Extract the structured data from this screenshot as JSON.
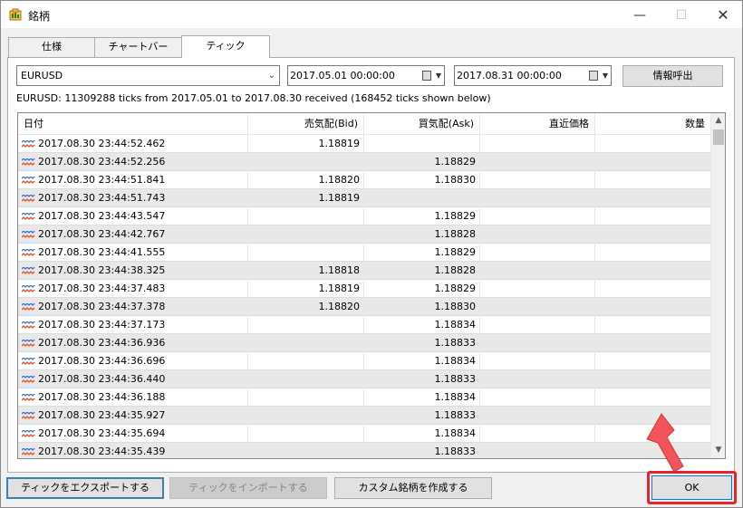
{
  "window": {
    "title": "銘柄",
    "minimize": "—",
    "maximize": "☐",
    "close": "✕"
  },
  "tabs": [
    {
      "label": "仕様"
    },
    {
      "label": "チャートバー"
    },
    {
      "label": "ティック"
    }
  ],
  "toolbar": {
    "symbol": "EURUSD",
    "date_from": "2017.05.01 00:00:00",
    "date_to": "2017.08.31 00:00:00",
    "fetch_label": "情報呼出"
  },
  "summary": "EURUSD: 11309288 ticks from 2017.05.01 to 2017.08.30 received (168452 ticks shown below)",
  "grid": {
    "columns": [
      "日付",
      "売気配(Bid)",
      "買気配(Ask)",
      "直近価格",
      "数量"
    ],
    "rows": [
      {
        "date": "2017.08.30 23:44:52.462",
        "bid": "1.18819",
        "ask": "",
        "last": "",
        "volume": ""
      },
      {
        "date": "2017.08.30 23:44:52.256",
        "bid": "",
        "ask": "1.18829",
        "last": "",
        "volume": ""
      },
      {
        "date": "2017.08.30 23:44:51.841",
        "bid": "1.18820",
        "ask": "1.18830",
        "last": "",
        "volume": ""
      },
      {
        "date": "2017.08.30 23:44:51.743",
        "bid": "1.18819",
        "ask": "",
        "last": "",
        "volume": ""
      },
      {
        "date": "2017.08.30 23:44:43.547",
        "bid": "",
        "ask": "1.18829",
        "last": "",
        "volume": ""
      },
      {
        "date": "2017.08.30 23:44:42.767",
        "bid": "",
        "ask": "1.18828",
        "last": "",
        "volume": ""
      },
      {
        "date": "2017.08.30 23:44:41.555",
        "bid": "",
        "ask": "1.18829",
        "last": "",
        "volume": ""
      },
      {
        "date": "2017.08.30 23:44:38.325",
        "bid": "1.18818",
        "ask": "1.18828",
        "last": "",
        "volume": ""
      },
      {
        "date": "2017.08.30 23:44:37.483",
        "bid": "1.18819",
        "ask": "1.18829",
        "last": "",
        "volume": ""
      },
      {
        "date": "2017.08.30 23:44:37.378",
        "bid": "1.18820",
        "ask": "1.18830",
        "last": "",
        "volume": ""
      },
      {
        "date": "2017.08.30 23:44:37.173",
        "bid": "",
        "ask": "1.18834",
        "last": "",
        "volume": ""
      },
      {
        "date": "2017.08.30 23:44:36.936",
        "bid": "",
        "ask": "1.18833",
        "last": "",
        "volume": ""
      },
      {
        "date": "2017.08.30 23:44:36.696",
        "bid": "",
        "ask": "1.18834",
        "last": "",
        "volume": ""
      },
      {
        "date": "2017.08.30 23:44:36.440",
        "bid": "",
        "ask": "1.18833",
        "last": "",
        "volume": ""
      },
      {
        "date": "2017.08.30 23:44:36.188",
        "bid": "",
        "ask": "1.18834",
        "last": "",
        "volume": ""
      },
      {
        "date": "2017.08.30 23:44:35.927",
        "bid": "",
        "ask": "1.18833",
        "last": "",
        "volume": ""
      },
      {
        "date": "2017.08.30 23:44:35.694",
        "bid": "",
        "ask": "1.18834",
        "last": "",
        "volume": ""
      },
      {
        "date": "2017.08.30 23:44:35.439",
        "bid": "",
        "ask": "1.18833",
        "last": "",
        "volume": ""
      }
    ]
  },
  "buttons": {
    "export": "ティックをエクスポートする",
    "import": "ティックをインポートする",
    "create_symbol": "カスタム銘柄を作成する",
    "ok": "OK"
  },
  "colors": {
    "highlight": "#e8232b",
    "pointer": "#f2545b",
    "tick_icon": "#3a6fd8",
    "tick_icon_alt": "#e05020"
  }
}
